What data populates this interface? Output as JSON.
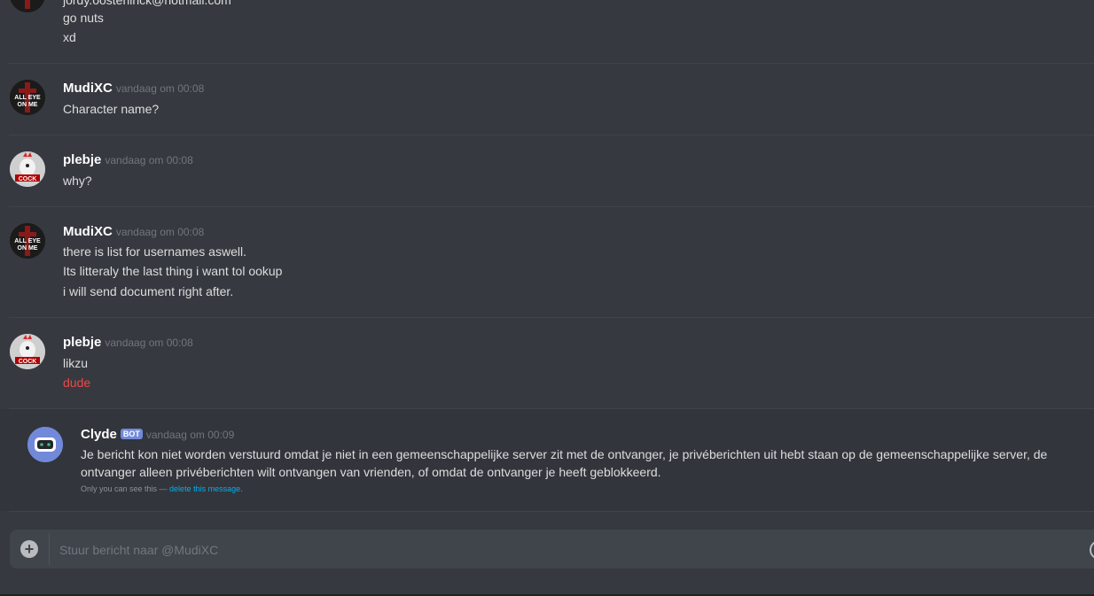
{
  "top_partial": {
    "email_line": "jordy.oosterlinck@hotmail.com",
    "lines": [
      "go nuts",
      "xd"
    ]
  },
  "messages": [
    {
      "author": "MudiXC",
      "timestamp": "vandaag om 00:08",
      "avatar_text": "ALL EYES ON ME",
      "lines": [
        "Character name?"
      ]
    },
    {
      "author": "plebje",
      "timestamp": "vandaag om 00:08",
      "avatar_text": "COCK",
      "lines": [
        "why?"
      ]
    },
    {
      "author": "MudiXC",
      "timestamp": "vandaag om 00:08",
      "avatar_text": "ALL EYES ON ME",
      "lines": [
        "there is list for usernames aswell.",
        "Its litteraly the last thing i want tol ookup",
        "i will send document right after."
      ]
    },
    {
      "author": "plebje",
      "timestamp": "vandaag om 00:08",
      "avatar_text": "COCK",
      "lines": [
        "likzu",
        "dude"
      ]
    }
  ],
  "clyde": {
    "author": "Clyde",
    "badge": "BOT",
    "timestamp": "vandaag om 00:09",
    "text": "Je bericht kon niet worden verstuurd omdat je niet in een gemeenschappelijke server zit met de ontvanger, je privéberichten uit hebt staan op de gemeenschappelijke server, de ontvanger alleen privéberichten wilt ontvangen van vrienden, of omdat de ontvanger je heeft geblokkeerd.",
    "ephemeral_prefix": "Only you can see this — ",
    "delete_link": "delete this message",
    "ephemeral_suffix": "."
  },
  "composer": {
    "placeholder": "Stuur bericht naar @MudiXC",
    "plus_glyph": "+"
  },
  "colors": {
    "background": "#36393f",
    "text": "#dcddde",
    "timestamp": "#72767d",
    "mention_red": "#f04747",
    "link": "#00b0f4",
    "blurple": "#7289da"
  }
}
